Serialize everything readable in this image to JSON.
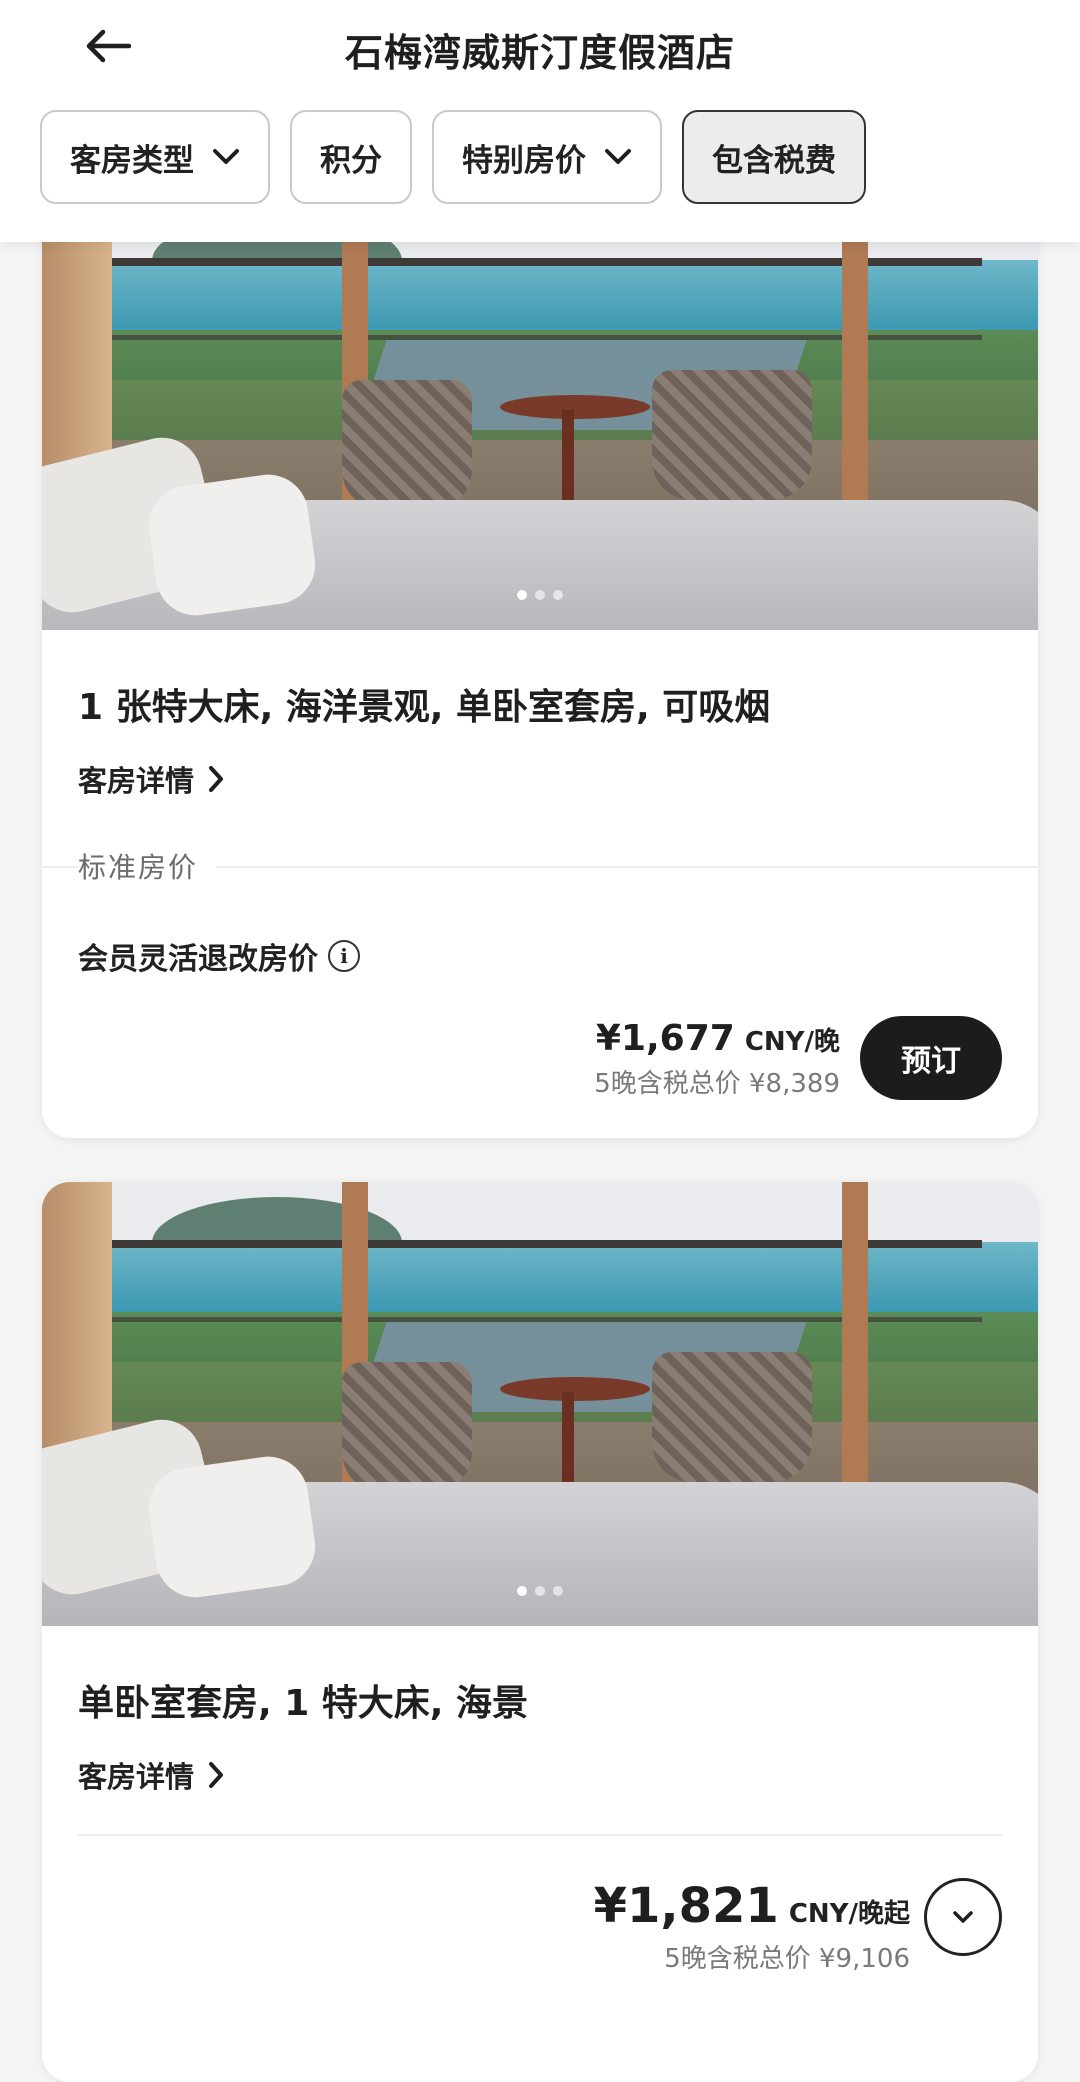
{
  "header": {
    "title": "石梅湾威斯汀度假酒店",
    "back_icon": "arrow-left-icon"
  },
  "filters": [
    {
      "label": "客房类型",
      "has_dropdown": true,
      "active": false
    },
    {
      "label": "积分",
      "has_dropdown": false,
      "active": false
    },
    {
      "label": "特别房价",
      "has_dropdown": true,
      "active": false
    },
    {
      "label": "包含税费",
      "has_dropdown": false,
      "active": true
    }
  ],
  "rooms": [
    {
      "title": "1 张特大床, 海洋景观, 单卧室套房, 可吸烟",
      "details_label": "客房详情",
      "section_label": "标准房价",
      "rate_name": "会员灵活退改房价",
      "price": "¥1,677",
      "price_unit": "CNY/晚",
      "total": "5晚含税总价 ¥8,389",
      "book_label": "预订",
      "carousel": {
        "count": 3,
        "active": 1
      }
    },
    {
      "title": "单卧室套房, 1 特大床, 海景",
      "details_label": "客房详情",
      "price": "¥1,821",
      "price_unit": "CNY/晚起",
      "total": "5晚含税总价 ¥9,106",
      "carousel": {
        "count": 3,
        "active": 1
      }
    }
  ]
}
